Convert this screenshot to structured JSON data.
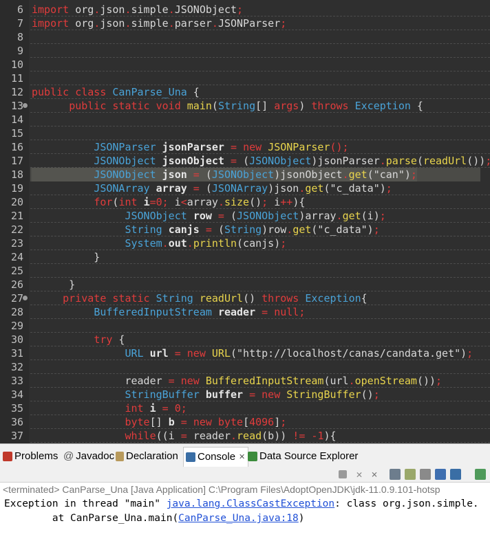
{
  "editor": {
    "lines": [
      {
        "n": "6",
        "tokens": [
          [
            "kw",
            "import"
          ],
          [
            "pl",
            " org"
          ],
          [
            "op",
            "."
          ],
          [
            "pl",
            "json"
          ],
          [
            "op",
            "."
          ],
          [
            "pl",
            "simple"
          ],
          [
            "op",
            "."
          ],
          [
            "pl",
            "JSONObject"
          ],
          [
            "op",
            ";"
          ]
        ]
      },
      {
        "n": "7",
        "tokens": [
          [
            "kw",
            "import"
          ],
          [
            "pl",
            " org"
          ],
          [
            "op",
            "."
          ],
          [
            "pl",
            "json"
          ],
          [
            "op",
            "."
          ],
          [
            "pl",
            "simple"
          ],
          [
            "op",
            "."
          ],
          [
            "pl",
            "parser"
          ],
          [
            "op",
            "."
          ],
          [
            "pl",
            "JSONParser"
          ],
          [
            "op",
            ";"
          ]
        ]
      },
      {
        "n": "8",
        "tokens": []
      },
      {
        "n": "9",
        "tokens": []
      },
      {
        "n": "10",
        "tokens": []
      },
      {
        "n": "11",
        "tokens": []
      },
      {
        "n": "12",
        "tokens": [
          [
            "kw",
            "public class "
          ],
          [
            "ty",
            "CanParse_Una"
          ],
          [
            "pl",
            " {"
          ]
        ]
      },
      {
        "n": "13",
        "dot": true,
        "tokens": [
          [
            "pl",
            "      "
          ],
          [
            "kw",
            "public static void "
          ],
          [
            "md",
            "main"
          ],
          [
            "pl",
            "("
          ],
          [
            "ty",
            "String"
          ],
          [
            "pl",
            "[] "
          ],
          [
            "kw",
            "args"
          ],
          [
            "pl",
            ") "
          ],
          [
            "kw",
            "throws "
          ],
          [
            "ty",
            "Exception"
          ],
          [
            "pl",
            " {"
          ]
        ]
      },
      {
        "n": "14",
        "tokens": []
      },
      {
        "n": "15",
        "tokens": []
      },
      {
        "n": "16",
        "tokens": [
          [
            "pl",
            "          "
          ],
          [
            "ty",
            "JSONParser "
          ],
          [
            "vd",
            "jsonParser"
          ],
          [
            "op",
            " = "
          ],
          [
            "kw",
            "new "
          ],
          [
            "md",
            "JSONParser"
          ],
          [
            "op",
            "();"
          ]
        ]
      },
      {
        "n": "17",
        "tokens": [
          [
            "pl",
            "          "
          ],
          [
            "ty",
            "JSONObject "
          ],
          [
            "vd",
            "jsonObject"
          ],
          [
            "op",
            " = "
          ],
          [
            "pl",
            "("
          ],
          [
            "ty",
            "JSONObject"
          ],
          [
            "pl",
            ")jsonParser"
          ],
          [
            "op",
            "."
          ],
          [
            "md",
            "parse"
          ],
          [
            "pl",
            "("
          ],
          [
            "md",
            "readUrl"
          ],
          [
            "pl",
            "())"
          ],
          [
            "op",
            ";"
          ]
        ]
      },
      {
        "n": "18",
        "hl": true,
        "tokens": [
          [
            "pl",
            "          "
          ],
          [
            "ty",
            "JSONObject "
          ],
          [
            "vd",
            "json"
          ],
          [
            "op",
            " = "
          ],
          [
            "pl",
            "("
          ],
          [
            "ty",
            "JSONObject"
          ],
          [
            "pl",
            ")jsonObject"
          ],
          [
            "op",
            "."
          ],
          [
            "md",
            "get"
          ],
          [
            "pl",
            "(\"can\")"
          ],
          [
            "op",
            ";"
          ]
        ]
      },
      {
        "n": "19",
        "tokens": [
          [
            "pl",
            "          "
          ],
          [
            "ty",
            "JSONArray "
          ],
          [
            "vd",
            "array"
          ],
          [
            "op",
            " = "
          ],
          [
            "pl",
            "("
          ],
          [
            "ty",
            "JSONArray"
          ],
          [
            "pl",
            ")json"
          ],
          [
            "op",
            "."
          ],
          [
            "md",
            "get"
          ],
          [
            "pl",
            "(\"c_data\")"
          ],
          [
            "op",
            ";"
          ]
        ]
      },
      {
        "n": "20",
        "tokens": [
          [
            "pl",
            "          "
          ],
          [
            "kw",
            "for"
          ],
          [
            "pl",
            "("
          ],
          [
            "kw",
            "int "
          ],
          [
            "vd",
            "i"
          ],
          [
            "op",
            "="
          ],
          [
            "num-lit",
            "0"
          ],
          [
            "op",
            "; "
          ],
          [
            "pl",
            "i"
          ],
          [
            "op",
            "<"
          ],
          [
            "pl",
            "array"
          ],
          [
            "op",
            "."
          ],
          [
            "md",
            "size"
          ],
          [
            "pl",
            "()"
          ],
          [
            "op",
            "; "
          ],
          [
            "pl",
            "i"
          ],
          [
            "op",
            "++"
          ],
          [
            "pl",
            "){"
          ]
        ]
      },
      {
        "n": "21",
        "tokens": [
          [
            "pl",
            "               "
          ],
          [
            "ty",
            "JSONObject "
          ],
          [
            "vd",
            "row"
          ],
          [
            "op",
            " = "
          ],
          [
            "pl",
            "("
          ],
          [
            "ty",
            "JSONObject"
          ],
          [
            "pl",
            ")array"
          ],
          [
            "op",
            "."
          ],
          [
            "md",
            "get"
          ],
          [
            "pl",
            "(i)"
          ],
          [
            "op",
            ";"
          ]
        ]
      },
      {
        "n": "22",
        "tokens": [
          [
            "pl",
            "               "
          ],
          [
            "ty",
            "String "
          ],
          [
            "vd",
            "canjs"
          ],
          [
            "op",
            " = "
          ],
          [
            "pl",
            "("
          ],
          [
            "ty",
            "String"
          ],
          [
            "pl",
            ")row"
          ],
          [
            "op",
            "."
          ],
          [
            "md",
            "get"
          ],
          [
            "pl",
            "(\"c_data\")"
          ],
          [
            "op",
            ";"
          ]
        ]
      },
      {
        "n": "23",
        "tokens": [
          [
            "pl",
            "               "
          ],
          [
            "ty",
            "System"
          ],
          [
            "op",
            "."
          ],
          [
            "vd",
            "out"
          ],
          [
            "op",
            "."
          ],
          [
            "md",
            "println"
          ],
          [
            "pl",
            "(canjs)"
          ],
          [
            "op",
            ";"
          ]
        ]
      },
      {
        "n": "24",
        "tokens": [
          [
            "pl",
            "          }"
          ]
        ]
      },
      {
        "n": "25",
        "tokens": []
      },
      {
        "n": "26",
        "tokens": [
          [
            "pl",
            "      }"
          ]
        ]
      },
      {
        "n": "27",
        "dot": true,
        "tokens": [
          [
            "pl",
            "     "
          ],
          [
            "kw",
            "private static "
          ],
          [
            "ty",
            "String "
          ],
          [
            "md",
            "readUrl"
          ],
          [
            "pl",
            "() "
          ],
          [
            "kw",
            "throws "
          ],
          [
            "ty",
            "Exception"
          ],
          [
            "pl",
            "{"
          ]
        ]
      },
      {
        "n": "28",
        "tokens": [
          [
            "pl",
            "          "
          ],
          [
            "ty",
            "BufferedInputStream "
          ],
          [
            "vd",
            "reader"
          ],
          [
            "op",
            " = "
          ],
          [
            "kw",
            "null"
          ],
          [
            "op",
            ";"
          ]
        ]
      },
      {
        "n": "29",
        "tokens": []
      },
      {
        "n": "30",
        "tokens": [
          [
            "pl",
            "          "
          ],
          [
            "kw",
            "try"
          ],
          [
            "pl",
            " {"
          ]
        ]
      },
      {
        "n": "31",
        "tokens": [
          [
            "pl",
            "               "
          ],
          [
            "ty",
            "URL "
          ],
          [
            "vd",
            "url"
          ],
          [
            "op",
            " = "
          ],
          [
            "kw",
            "new "
          ],
          [
            "md",
            "URL"
          ],
          [
            "pl",
            "(\"http://localhost/canas/candata.get\")"
          ],
          [
            "op",
            ";"
          ]
        ]
      },
      {
        "n": "32",
        "tokens": []
      },
      {
        "n": "33",
        "tokens": [
          [
            "pl",
            "               reader"
          ],
          [
            "op",
            " = "
          ],
          [
            "kw",
            "new "
          ],
          [
            "md",
            "BufferedInputStream"
          ],
          [
            "pl",
            "(url"
          ],
          [
            "op",
            "."
          ],
          [
            "md",
            "openStream"
          ],
          [
            "pl",
            "())"
          ],
          [
            "op",
            ";"
          ]
        ]
      },
      {
        "n": "34",
        "tokens": [
          [
            "pl",
            "               "
          ],
          [
            "ty",
            "StringBuffer "
          ],
          [
            "vd",
            "buffer"
          ],
          [
            "op",
            " = "
          ],
          [
            "kw",
            "new "
          ],
          [
            "md",
            "StringBuffer"
          ],
          [
            "pl",
            "()"
          ],
          [
            "op",
            ";"
          ]
        ]
      },
      {
        "n": "35",
        "tokens": [
          [
            "pl",
            "               "
          ],
          [
            "kw",
            "int "
          ],
          [
            "vd",
            "i"
          ],
          [
            "op",
            " = "
          ],
          [
            "num-lit",
            "0"
          ],
          [
            "op",
            ";"
          ]
        ]
      },
      {
        "n": "36",
        "tokens": [
          [
            "pl",
            "               "
          ],
          [
            "kw",
            "byte"
          ],
          [
            "pl",
            "[] "
          ],
          [
            "vd",
            "b"
          ],
          [
            "op",
            " = "
          ],
          [
            "kw",
            "new byte"
          ],
          [
            "pl",
            "["
          ],
          [
            "num-lit",
            "4096"
          ],
          [
            "pl",
            "]"
          ],
          [
            "op",
            ";"
          ]
        ]
      },
      {
        "n": "37",
        "tokens": [
          [
            "pl",
            "               "
          ],
          [
            "kw",
            "while"
          ],
          [
            "pl",
            "((i"
          ],
          [
            "op",
            " = "
          ],
          [
            "pl",
            "reader"
          ],
          [
            "op",
            "."
          ],
          [
            "md",
            "read"
          ],
          [
            "pl",
            "(b))"
          ],
          [
            "op",
            " != -"
          ],
          [
            "num-lit",
            "1"
          ],
          [
            "pl",
            "){"
          ]
        ]
      }
    ]
  },
  "panel": {
    "tabs": [
      {
        "label": "Problems",
        "icon": "problems-icon",
        "color": "#c0392b"
      },
      {
        "label": "Javadoc",
        "icon": "at-icon",
        "color": "#555555"
      },
      {
        "label": "Declaration",
        "icon": "declaration-icon",
        "color": "#7a5c2e"
      },
      {
        "label": "Console",
        "icon": "console-icon",
        "color": "#3a6ea5",
        "active": true,
        "close": "✕"
      },
      {
        "label": "Data Source Explorer",
        "icon": "datasource-icon",
        "color": "#3c8c3c"
      }
    ],
    "console": {
      "terminated": "<terminated> CanParse_Una [Java Application] C:\\Program Files\\AdoptOpenJDK\\jdk-11.0.9.101-hotsp",
      "line1_prefix": "Exception in thread \"main\" ",
      "line1_link": "java.lang.ClassCastException",
      "line1_suffix": ": class org.json.simple.",
      "line2_prefix": "\tat CanParse_Una.main(",
      "line2_link": "CanParse_Una.java:18",
      "line2_suffix": ")"
    }
  }
}
